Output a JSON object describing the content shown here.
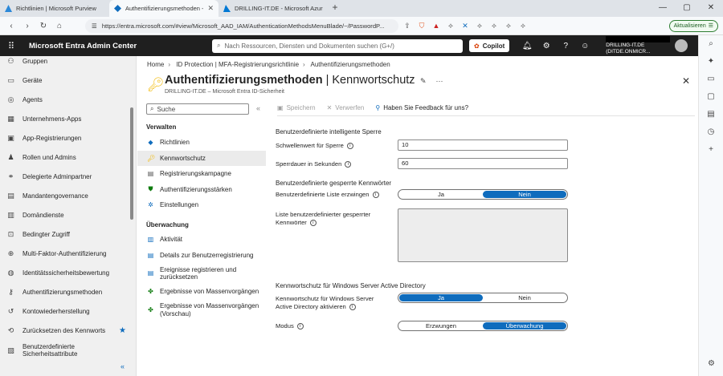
{
  "browser": {
    "tabs": [
      {
        "title": "Richtlinien | Microsoft Purview",
        "active": false
      },
      {
        "title": "Authentifizierungsmethoden - M",
        "active": true
      },
      {
        "title": "DRILLING-IT.DE - Microsoft Azure",
        "active": false
      }
    ],
    "url": "https://entra.microsoft.com/#view/Microsoft_AAD_IAM/AuthenticationMethodsMenuBlade/~/PasswordP...",
    "update_label": "Aktualisieren"
  },
  "portal": {
    "brand": "Microsoft Entra Admin Center",
    "search_placeholder": "Nach Ressourcen, Diensten und Dokumenten suchen (G+/)",
    "copilot_label": "Copilot",
    "tenant": "DRILLING-IT.DE (DITDE.ONMICR..."
  },
  "leftnav": {
    "items": [
      {
        "label": "Gruppen",
        "icon": "group-icon"
      },
      {
        "label": "Geräte",
        "icon": "device-icon"
      },
      {
        "label": "Agents",
        "icon": "agent-icon"
      },
      {
        "label": "Unternehmens-Apps",
        "icon": "grid-icon"
      },
      {
        "label": "App-Registrierungen",
        "icon": "app-icon"
      },
      {
        "label": "Rollen und Admins",
        "icon": "roles-icon"
      },
      {
        "label": "Delegierte Adminpartner",
        "icon": "partner-icon"
      },
      {
        "label": "Mandantengovernance",
        "icon": "governance-icon"
      },
      {
        "label": "Domändienste",
        "icon": "domain-icon"
      },
      {
        "label": "Bedingter Zugriff",
        "icon": "lock-icon"
      },
      {
        "label": "Multi-Faktor-Authentifizierung",
        "icon": "mfa-icon"
      },
      {
        "label": "Identitätssicherheitsbewertung",
        "icon": "score-icon"
      },
      {
        "label": "Authentifizierungsmethoden",
        "icon": "key-icon"
      },
      {
        "label": "Kontowiederherstellung",
        "icon": "recovery-icon"
      },
      {
        "label": "Zurücksetzen des Kennworts",
        "icon": "reset-icon"
      },
      {
        "label": "Benutzerdefinierte Sicherheitsattribute",
        "icon": "attribute-icon"
      }
    ]
  },
  "breadcrumb": [
    "Home",
    "ID Protection | MFA-Registrierungsrichtlinie",
    "Authentifizierungsmethoden"
  ],
  "blade": {
    "title_main": "Authentifizierungsmethoden",
    "title_sep": " | ",
    "title_sub": "Kennwortschutz",
    "subtitle": "DRILLING-IT.DE – Microsoft Entra ID-Sicherheit",
    "search_placeholder": "Suche",
    "section_manage": "Verwalten",
    "manage_items": [
      {
        "label": "Richtlinien",
        "icon": "policy-icon"
      },
      {
        "label": "Kennwortschutz",
        "icon": "key-icon"
      },
      {
        "label": "Registrierungskampagne",
        "icon": "campaign-icon"
      },
      {
        "label": "Authentifizierungsstärken",
        "icon": "shield-icon"
      },
      {
        "label": "Einstellungen",
        "icon": "settings-icon"
      }
    ],
    "section_monitor": "Überwachung",
    "monitor_items": [
      {
        "label": "Aktivität",
        "icon": "activity-icon"
      },
      {
        "label": "Details zur Benutzerregistrierung",
        "icon": "details-icon"
      },
      {
        "label": "Ereignisse registrieren und zurücksetzen",
        "icon": "events-icon"
      },
      {
        "label": "Ergebnisse von Massenvorgängen",
        "icon": "bulk-icon"
      },
      {
        "label": "Ergebnisse von Massenvorgängen (Vorschau)",
        "icon": "bulk-preview-icon"
      }
    ]
  },
  "toolbar": {
    "save": "Speichern",
    "discard": "Verwerfen",
    "feedback": "Haben Sie Feedback für uns?"
  },
  "form": {
    "lockout_header": "Benutzerdefinierte intelligente Sperre",
    "threshold_label": "Schwellenwert für Sperre",
    "threshold_value": "10",
    "duration_label": "Sperrdauer in Sekunden",
    "duration_value": "60",
    "banned_header": "Benutzerdefinierte gesperrte Kennwörter",
    "enforce_label": "Benutzerdefinierte Liste erzwingen",
    "enforce_options": [
      "Ja",
      "Nein"
    ],
    "enforce_selected": "Nein",
    "list_label_1": "Liste benutzerdefinierter gesperrter",
    "list_label_2": "Kennwörter",
    "ad_header": "Kennwortschutz für Windows Server Active Directory",
    "ad_label_1": "Kennwortschutz für Windows Server",
    "ad_label_2": "Active Directory aktivieren",
    "ad_options": [
      "Ja",
      "Nein"
    ],
    "ad_selected": "Ja",
    "mode_label": "Modus",
    "mode_options": [
      "Erzwungen",
      "Überwachung"
    ],
    "mode_selected": "Überwachung"
  }
}
